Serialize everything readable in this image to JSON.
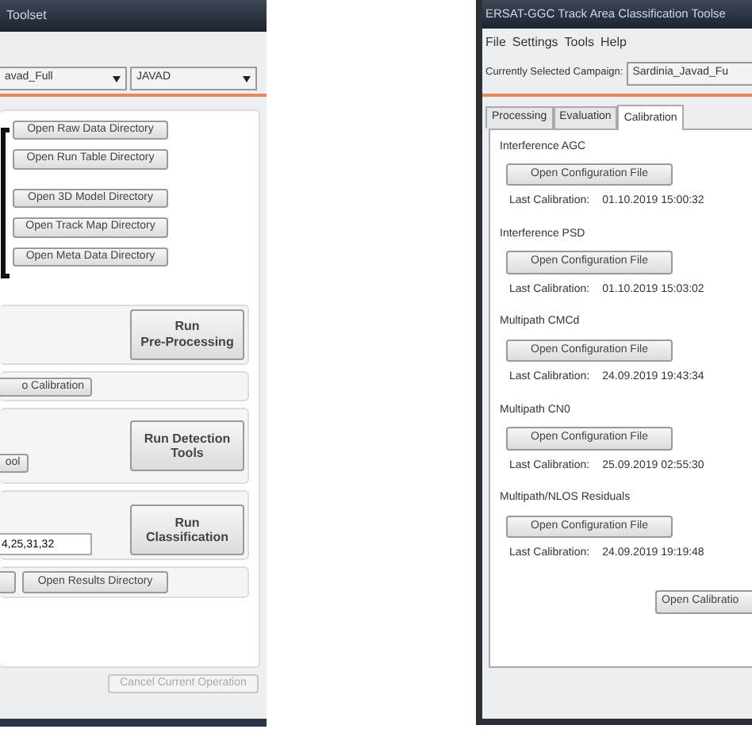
{
  "left_window": {
    "title": "Toolset",
    "dropdowns": [
      "avad_Full",
      "JAVAD"
    ],
    "directory_buttons": [
      "Open Raw Data Directory",
      "Open Run Table Directory",
      "Open 3D Model Directory",
      "Open Track Map Directory",
      "Open Meta Data Directory"
    ],
    "preprocessing_button": "Run\nPre-Processing",
    "calibration_button": "o Calibration",
    "detection": {
      "tool_button": "ool",
      "run_button": "Run Detection\nTools"
    },
    "classification": {
      "value": "4,25,31,32",
      "run_button": "Run\nClassification"
    },
    "results_button": "Open Results Directory",
    "cancel_button": {
      "label": "Cancel Current Operation",
      "disabled": true
    }
  },
  "right_window": {
    "title": "ERSAT-GGC Track Area Classification Toolse",
    "menu": [
      "File",
      "Settings",
      "Tools",
      "Help"
    ],
    "campaign_label": "Currently Selected Campaign:",
    "campaign_value": "Sardinia_Javad_Fu",
    "tabs": [
      {
        "label": "Processing",
        "selected": false
      },
      {
        "label": "Evaluation",
        "selected": false
      },
      {
        "label": "Calibration",
        "selected": true
      }
    ],
    "calibration_groups": [
      {
        "title": "Interference AGC",
        "button": "Open Configuration File",
        "last_label": "Last Calibration:",
        "last_value": "01.10.2019 15:00:32"
      },
      {
        "title": "Interference PSD",
        "button": "Open Configuration File",
        "last_label": "Last Calibration:",
        "last_value": "01.10.2019 15:03:02"
      },
      {
        "title": "Multipath CMCd",
        "button": "Open Configuration File",
        "last_label": "Last Calibration:",
        "last_value": "24.09.2019 19:43:34"
      },
      {
        "title": "Multipath CN0",
        "button": "Open Configuration File",
        "last_label": "Last Calibration:",
        "last_value": "25.09.2019 02:55:30"
      },
      {
        "title": "Multipath/NLOS Residuals",
        "button": "Open Configuration File",
        "last_label": "Last Calibration:",
        "last_value": "24.09.2019 19:19:48"
      }
    ],
    "open_calibration_button": "Open Calibratio"
  }
}
